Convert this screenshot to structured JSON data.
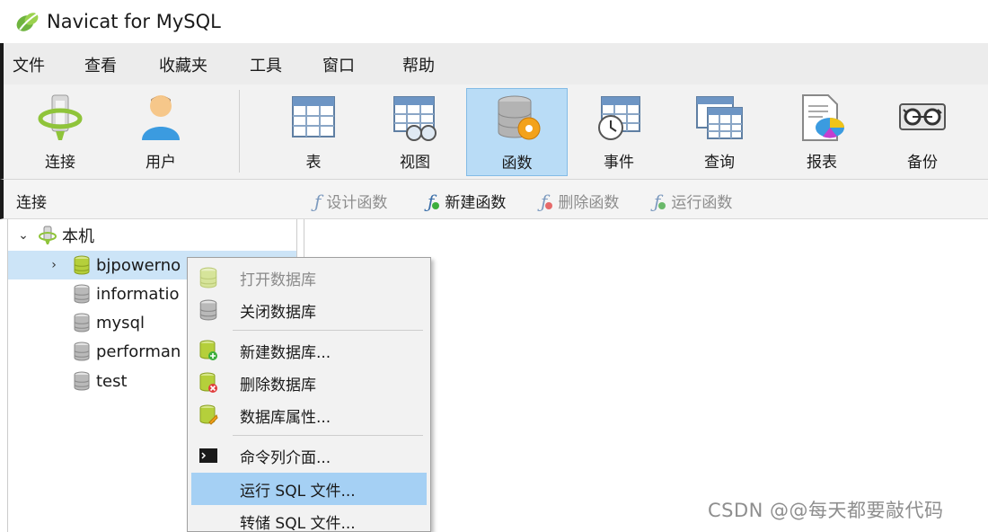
{
  "window": {
    "title": "Navicat for MySQL"
  },
  "menu": [
    "文件",
    "查看",
    "收藏夹",
    "工具",
    "窗口",
    "帮助"
  ],
  "toolbar": {
    "items": [
      {
        "label": "连接",
        "icon": "connection-icon",
        "active": false
      },
      {
        "label": "用户",
        "icon": "user-icon",
        "active": false
      },
      {
        "label": "表",
        "icon": "table-icon",
        "active": false
      },
      {
        "label": "视图",
        "icon": "view-icon",
        "active": false
      },
      {
        "label": "函数",
        "icon": "function-icon",
        "active": true
      },
      {
        "label": "事件",
        "icon": "event-icon",
        "active": false
      },
      {
        "label": "查询",
        "icon": "query-icon",
        "active": false
      },
      {
        "label": "报表",
        "icon": "report-icon",
        "active": false
      },
      {
        "label": "备份",
        "icon": "backup-icon",
        "active": false
      }
    ]
  },
  "subbar": {
    "connection_label": "连接",
    "actions": [
      {
        "label": "设计函数",
        "enabled": false
      },
      {
        "label": "新建函数",
        "enabled": true
      },
      {
        "label": "删除函数",
        "enabled": false
      },
      {
        "label": "运行函数",
        "enabled": false
      }
    ]
  },
  "tree": {
    "root": "本机",
    "databases": [
      {
        "name": "bjpowernode",
        "display": "bjpowerno",
        "selected": true,
        "open": true
      },
      {
        "name": "information_schema",
        "display": "informatio",
        "selected": false,
        "open": false
      },
      {
        "name": "mysql",
        "display": "mysql",
        "selected": false,
        "open": false
      },
      {
        "name": "performance_schema",
        "display": "performan",
        "selected": false,
        "open": false
      },
      {
        "name": "test",
        "display": "test",
        "selected": false,
        "open": false
      }
    ]
  },
  "context_menu": {
    "items": [
      {
        "label": "打开数据库",
        "icon": "database-open-icon",
        "enabled": false
      },
      {
        "label": "关闭数据库",
        "icon": "database-close-icon",
        "enabled": true
      },
      {
        "label": "新建数据库...",
        "icon": "database-add-icon",
        "enabled": true
      },
      {
        "label": "删除数据库",
        "icon": "database-delete-icon",
        "enabled": true
      },
      {
        "label": "数据库属性...",
        "icon": "database-properties-icon",
        "enabled": true
      },
      {
        "label": "命令列介面...",
        "icon": "console-icon",
        "enabled": true
      },
      {
        "label": "运行 SQL 文件...",
        "icon": "",
        "enabled": true,
        "highlighted": true
      },
      {
        "label": "转储 SQL 文件...",
        "icon": "",
        "enabled": true
      }
    ]
  },
  "watermark": "CSDN @@每天都要敲代码",
  "colors": {
    "active_tool": "#b9dcf6",
    "selection": "#cce4f7",
    "menu_highlight": "#a5d0f4",
    "db_open": "#b5cf3b",
    "db_closed": "#b9b9b9"
  }
}
